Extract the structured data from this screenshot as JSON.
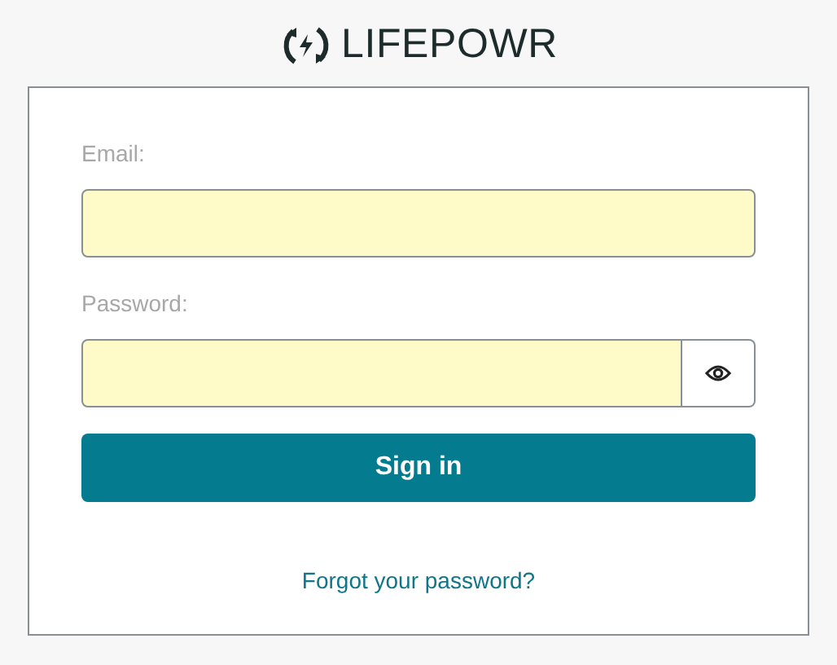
{
  "logo": {
    "text": "LIFEPOWR"
  },
  "email": {
    "label": "Email:"
  },
  "password": {
    "label": "Password:"
  },
  "sign_in": {
    "label": "Sign in"
  },
  "forgot_link": {
    "label": "Forgot your password?"
  }
}
